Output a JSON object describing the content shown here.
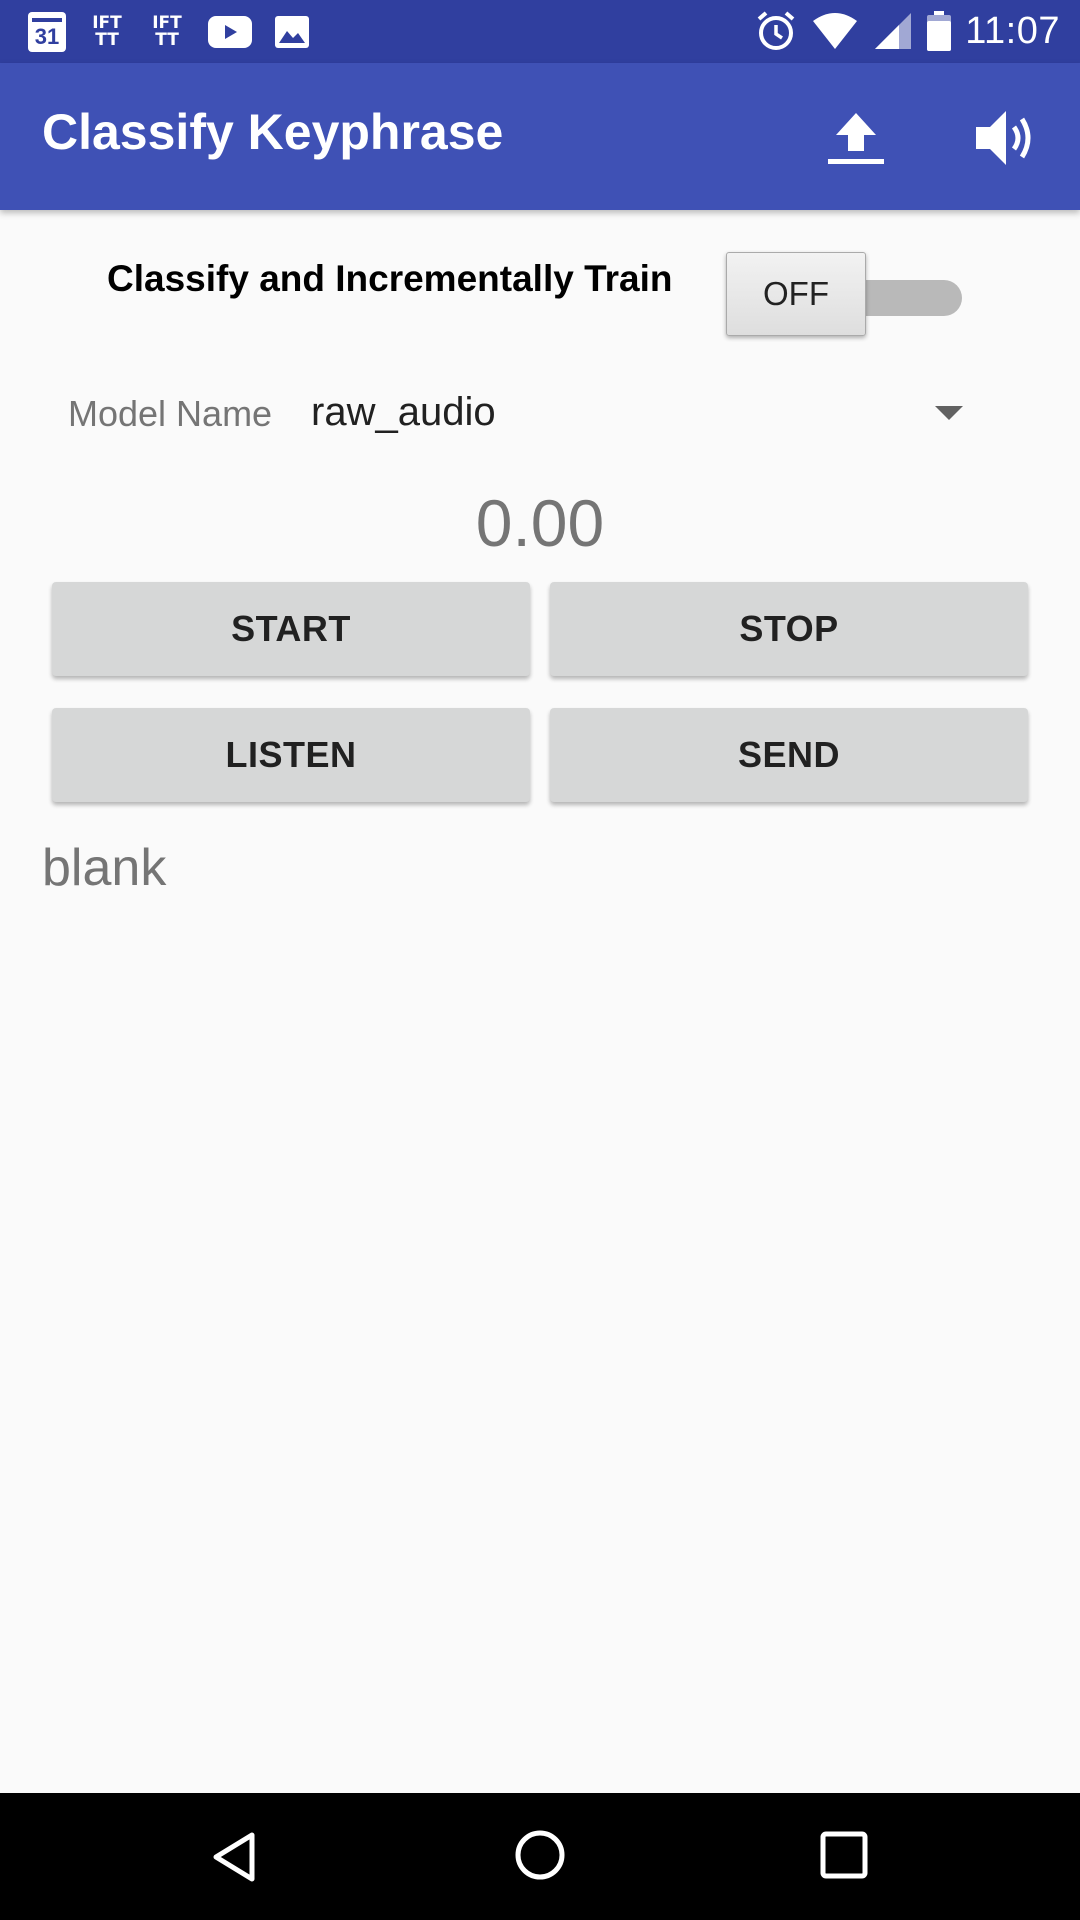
{
  "status_bar": {
    "calendar_day": "31",
    "ifttt_1": "IFT TT",
    "ifttt_2": "IFT TT",
    "time": "11:07",
    "icons": [
      "calendar-icon",
      "ifttt-icon",
      "ifttt-icon",
      "youtube-icon",
      "image-icon",
      "alarm-icon",
      "wifi-icon",
      "signal-icon",
      "battery-icon"
    ]
  },
  "app_bar": {
    "title": "Classify Keyphrase",
    "actions": [
      "upload-icon",
      "speaker-icon"
    ],
    "color": "#3f51b5"
  },
  "toggle": {
    "label": "Classify and Incrementally Train",
    "state": "OFF"
  },
  "model": {
    "label": "Model Name",
    "selected": "raw_audio"
  },
  "score": "0.00",
  "buttons": {
    "start": "START",
    "stop": "STOP",
    "listen": "LISTEN",
    "send": "SEND"
  },
  "result": "blank",
  "nav_bar": {
    "icons": [
      "back-icon",
      "home-icon",
      "recents-icon"
    ]
  }
}
